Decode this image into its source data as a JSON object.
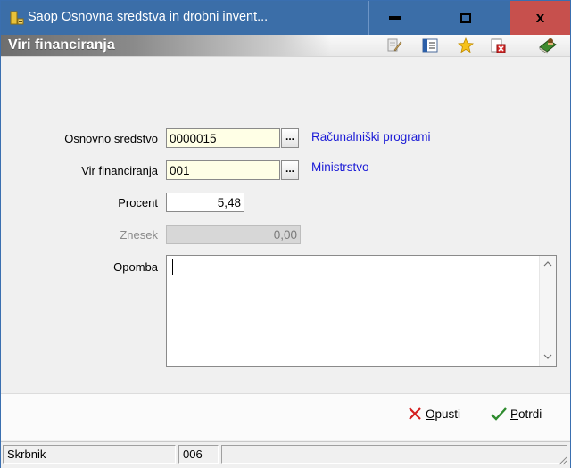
{
  "window": {
    "title": "Saop Osnovna sredstva in drobni invent...",
    "min_glyph": "▬",
    "max_glyph": "☐",
    "close_glyph": "x"
  },
  "header": {
    "title": "Viri financiranja",
    "icons": [
      "edit-icon",
      "list-icon",
      "star-icon",
      "delete-icon",
      "book-icon"
    ]
  },
  "form": {
    "osnovno_sredstvo": {
      "label": "Osnovno sredstvo",
      "value": "0000015",
      "desc": "Računalniški programi"
    },
    "vir_financiranja": {
      "label": "Vir financiranja",
      "value": "001",
      "desc": "Ministrstvo"
    },
    "procent": {
      "label": "Procent",
      "value": "5,48"
    },
    "znesek": {
      "label": "Znesek",
      "value": "0,00"
    },
    "opomba": {
      "label": "Opomba",
      "value": ""
    },
    "browse_label": "..."
  },
  "footer": {
    "cancel_u": "O",
    "cancel_rest": "pusti",
    "confirm_u": "P",
    "confirm_rest": "otrdi"
  },
  "status": {
    "user_label": "Skrbnik",
    "code": "006",
    "extra": ""
  },
  "colors": {
    "titlebar": "#3b6ea8",
    "close": "#c7504d",
    "link": "#1a1ad6",
    "highlight_field": "#ffffe6"
  }
}
